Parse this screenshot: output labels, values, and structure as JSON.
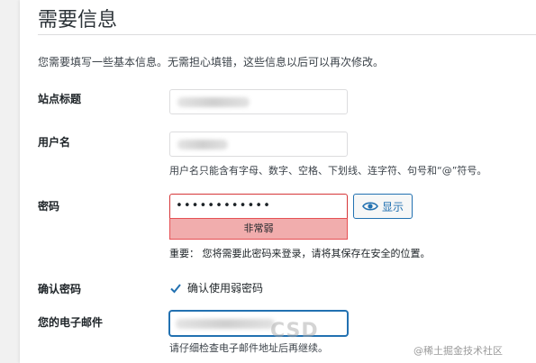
{
  "page": {
    "heading": "需要信息",
    "intro": "您需要填写一些基本信息。无需担心填错，这些信息以后可以再次修改。"
  },
  "site_title": {
    "label": "站点标题"
  },
  "username": {
    "label": "用户名",
    "hint": "用户名只能含有字母、数字、空格、下划线、连字符、句号和“@”符号。"
  },
  "password": {
    "label": "密码",
    "value": "••••••••••••",
    "strength": "非常弱",
    "show_button": "显示",
    "important": "重要：  您将需要此密码来登录，请将其保存在安全的位置。"
  },
  "confirm_password": {
    "label": "确认密码",
    "checkbox_label": "确认使用弱密码",
    "checked": true
  },
  "email": {
    "label": "您的电子邮件",
    "hint": "请仔细检查电子邮件地址后再继续。"
  },
  "watermark": {
    "logo": "CSD",
    "text": "@稀土掘金技术社区"
  },
  "colors": {
    "accent": "#2271b1",
    "error": "#d63638",
    "weak_bg": "#f1adad"
  },
  "icons": {
    "show": "eye-icon",
    "confirm": "checkmark-icon"
  }
}
